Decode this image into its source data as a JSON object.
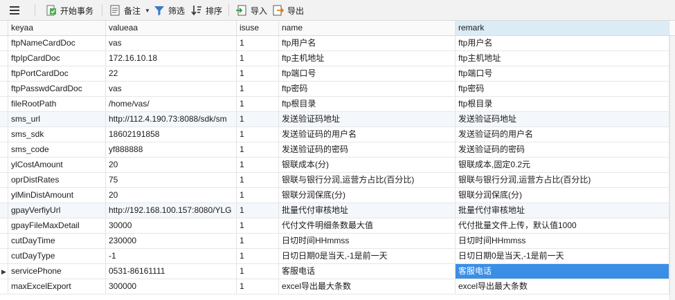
{
  "toolbar": {
    "begin_transaction": "开始事务",
    "memo": "备注",
    "filter": "筛选",
    "sort": "排序",
    "import": "导入",
    "export": "导出"
  },
  "columns": [
    "keyaa",
    "valueaa",
    "isuse",
    "name",
    "remark"
  ],
  "rows": [
    [
      "ftpNameCardDoc",
      "vas",
      "1",
      "ftp用户名",
      "ftp用户名"
    ],
    [
      "ftpIpCardDoc",
      "172.16.10.18",
      "1",
      "ftp主机地址",
      "ftp主机地址"
    ],
    [
      "ftpPortCardDoc",
      "22",
      "1",
      "ftp端口号",
      "ftp端口号"
    ],
    [
      "ftpPasswdCardDoc",
      "vas",
      "1",
      "ftp密码",
      "ftp密码"
    ],
    [
      "fileRootPath",
      "/home/vas/",
      "1",
      "ftp根目录",
      "ftp根目录"
    ],
    [
      "sms_url",
      "http://112.4.190.73:8088/sdk/sm",
      "1",
      "发送验证码地址",
      "发送验证码地址"
    ],
    [
      "sms_sdk",
      "18602191858",
      "1",
      "发送验证码的用户名",
      "发送验证码的用户名"
    ],
    [
      "sms_code",
      "yf888888",
      "1",
      "发送验证码的密码",
      "发送验证码的密码"
    ],
    [
      "ylCostAmount",
      "20",
      "1",
      "银联成本(分)",
      "银联成本,固定0.2元"
    ],
    [
      "oprDistRates",
      "75",
      "1",
      "银联与银行分润,运营方占比(百分比)",
      "银联与银行分润,运营方占比(百分比)"
    ],
    [
      "ylMinDistAmount",
      "20",
      "1",
      "银联分润保底(分)",
      "银联分润保底(分)"
    ],
    [
      "gpayVerfiyUrl",
      "http://192.168.100.157:8080/YLG",
      "1",
      "批量代付审核地址",
      "批量代付审核地址"
    ],
    [
      "gpayFileMaxDetail",
      "30000",
      "1",
      "代付文件明细条数最大值",
      "代付批量文件上传，默认值1000"
    ],
    [
      "cutDayTime",
      "230000",
      "1",
      "日切时间HHmmss",
      "日切时间HHmmss"
    ],
    [
      "cutDayType",
      "-1",
      "1",
      "日切日期0是当天,-1是前一天",
      "日切日期0是当天,-1是前一天"
    ],
    [
      "servicePhone",
      "0531-86161111",
      "1",
      "客服电话",
      "客服电话"
    ],
    [
      "maxExcelExport",
      "300000",
      "1",
      "excel导出最大条数",
      "excel导出最大条数"
    ]
  ],
  "selected_row_index": 15,
  "colors": {
    "selection": "#3a8ee6",
    "header_highlight": "#dcecf7",
    "row_alt": "#f4f7fb"
  }
}
